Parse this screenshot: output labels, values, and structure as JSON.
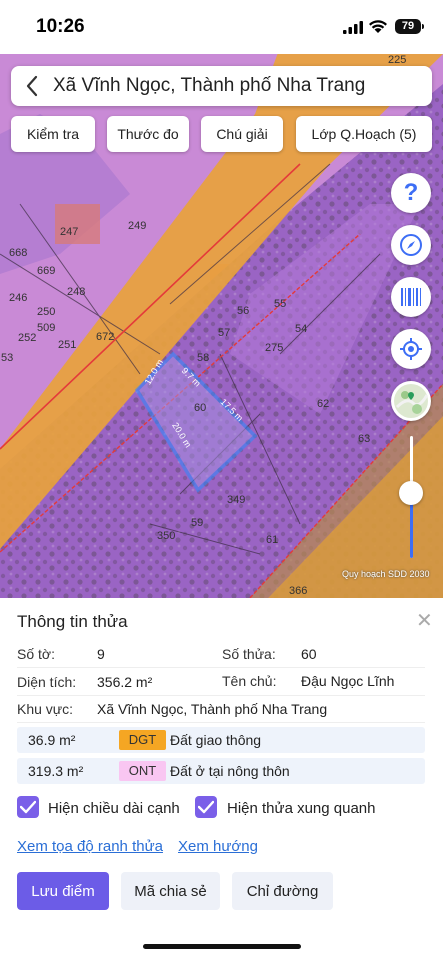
{
  "status": {
    "time": "10:26",
    "battery": "79"
  },
  "header": {
    "title": "Xã Vĩnh Ngọc, Thành phố Nha Trang"
  },
  "toolbar": {
    "check": "Kiểm tra",
    "measure": "Thước đo",
    "legend": "Chú giải",
    "layers": "Lớp Q.Hoạch (5)"
  },
  "map": {
    "parcel_labels": [
      "225",
      "249",
      "247",
      "668",
      "669",
      "248",
      "246",
      "250",
      "509",
      "672",
      "252",
      "251",
      "53",
      "56",
      "55",
      "57",
      "54",
      "275",
      "58",
      "60",
      "62",
      "63",
      "349",
      "59",
      "350",
      "61",
      "366"
    ],
    "edge_labels": [
      "12.0 m",
      "9.7 m",
      "17.5 m",
      "20.0 m"
    ],
    "watermark": "Quy hoạch SDD 2030"
  },
  "icons": {
    "help": "help-icon",
    "compass": "compass-icon",
    "barcode": "barcode-icon",
    "locate": "locate-icon",
    "layers": "map-thumbnail-icon"
  },
  "colors": {
    "accent": "#3d6ef5",
    "button": "#6c5ce7",
    "road": "#e8a23c",
    "residential": "#b57ad8"
  },
  "panel": {
    "title": "Thông tin thửa",
    "sheet_label": "Số tờ:",
    "sheet_value": "9",
    "lot_label": "Số thửa:",
    "lot_value": "60",
    "area_label": "Diện tích:",
    "area_value": "356.2 m²",
    "owner_label": "Tên chủ:",
    "owner_value": "Đậu Ngọc Lĩnh",
    "region_label": "Khu vực:",
    "region_value": "Xã Vĩnh Ngọc, Thành phố Nha Trang",
    "usages": [
      {
        "area": "36.9 m²",
        "code": "DGT",
        "desc": "Đất giao thông",
        "color": "#f5a623"
      },
      {
        "area": "319.3 m²",
        "code": "ONT",
        "desc": "Đất ở tại nông thôn",
        "color": "#f9c6f2"
      }
    ],
    "show_edge_length": "Hiện chiều dài cạnh",
    "show_neighbors": "Hiện thửa xung quanh",
    "link_coords": "Xem tọa độ ranh thửa",
    "link_direction": "Xem hướng",
    "save_button": "Lưu điểm",
    "share_button": "Mã chia sẻ",
    "directions_button": "Chỉ đường"
  }
}
